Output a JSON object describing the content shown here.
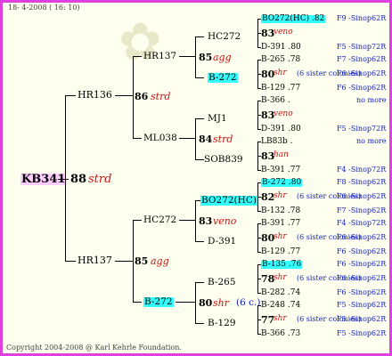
{
  "header_date": "18-  4-2008 ( 16: 10)",
  "footer_copyright": "Copyright 2004-2008 @ Karl Kehrle Foundation.",
  "subject": {
    "id": "KB341",
    "num": "88",
    "breed": "strd"
  },
  "gen1": {
    "top": "HR136",
    "bottom": "HR137"
  },
  "gen2": {
    "tl_id": "HR137",
    "tl_num": "86",
    "tl_breed": "strd",
    "bl_id": "ML038",
    "tr_id": "HC272",
    "tr_num": "85",
    "tr_breed": "agg",
    "br_id": "B-272"
  },
  "top_block": {
    "r1": {
      "id": "HR137",
      "num": "86",
      "breed": "strd"
    },
    "r1a": "HC272",
    "r1a_num": "85",
    "r1a_breed": "agg",
    "r1b": "B-272",
    "r2": {
      "id": "ML038"
    },
    "r2a": "MJ1",
    "r2a_num": "84",
    "r2a_breed": "strd",
    "r2b": "SOB839"
  },
  "bottom_block": {
    "r1": {
      "id": "HC272",
      "num": "83",
      "breed": "veno"
    },
    "r1a": "BO272(HC)",
    "r1b": "D-391",
    "r2": {
      "id": "B-272",
      "num": "80",
      "breed": "shr",
      "note": "(6 c.)"
    },
    "r2a": "B-265",
    "r2b": "B-129"
  },
  "gen4": [
    {
      "id": "BO272(HC) .82",
      "num": "83",
      "breed": "veno",
      "child": "D-391 .80",
      "loc_top": "F9 -Sinop62R",
      "loc_bottom": "F5 -Sinop72R",
      "cyan": true
    },
    {
      "id": "B-265 .78",
      "num": "80",
      "breed": "shr",
      "note": "(6 sister colonies)",
      "child": "B-129 .77",
      "loc_top": "F7 -Sinop62R",
      "loc_mid": "F6 -Sinop62R",
      "loc_bottom": "F6 -Sinop62R"
    },
    {
      "id": "B-366 .",
      "num": "83",
      "breed": "veno",
      "child": "D-391 .80",
      "loc_top": "no more",
      "loc_bottom": "F5 -Sinop72R"
    },
    {
      "id": "LB83b .",
      "num": "83",
      "breed": "han",
      "child": "B-391 .77",
      "loc_top": "no more",
      "loc_bottom": "F4 -Sinop72R"
    },
    {
      "id": "B-272 .80",
      "num": "82",
      "breed": "shr",
      "note": "(6 sister colonies)",
      "child": "B-132 .78",
      "loc_top": "F8 -Sinop62R",
      "loc_mid": "F6 -Sinop62R",
      "loc_bottom": "F7 -Sinop62R",
      "cyan": true
    },
    {
      "id": "B-391 .77",
      "num": "80",
      "breed": "shr",
      "note": "(6 sister colonies)",
      "child": "B-129 .77",
      "loc_top": "F4 -Sinop72R",
      "loc_mid": "F6 -Sinop62R",
      "loc_bottom": "F6 -Sinop62R"
    },
    {
      "id": "B-135 .76",
      "num": "78",
      "breed": "shr",
      "note": "(6 sister colonies)",
      "child": "B-282 .74",
      "loc_top": "F6 -Sinop62R",
      "loc_mid": "F6 -Sinop62R",
      "loc_bottom": "F6 -Sinop62R",
      "cyan": true
    },
    {
      "id": "B-248 .74",
      "num": "77",
      "breed": "shr",
      "note": "(6 sister colonies)",
      "child": "B-366 .73",
      "loc_top": "F5 -Sinop62R",
      "loc_mid": "F5 -Sinop62R",
      "loc_bottom": "F5 -Sinop62R"
    }
  ],
  "colors": {
    "border": "#e040e0",
    "highlight_cyan": "#33ffff",
    "highlight_pink": "#ffccff",
    "red": "#d01010",
    "blue": "#1020c0",
    "background": "#fffff0"
  }
}
